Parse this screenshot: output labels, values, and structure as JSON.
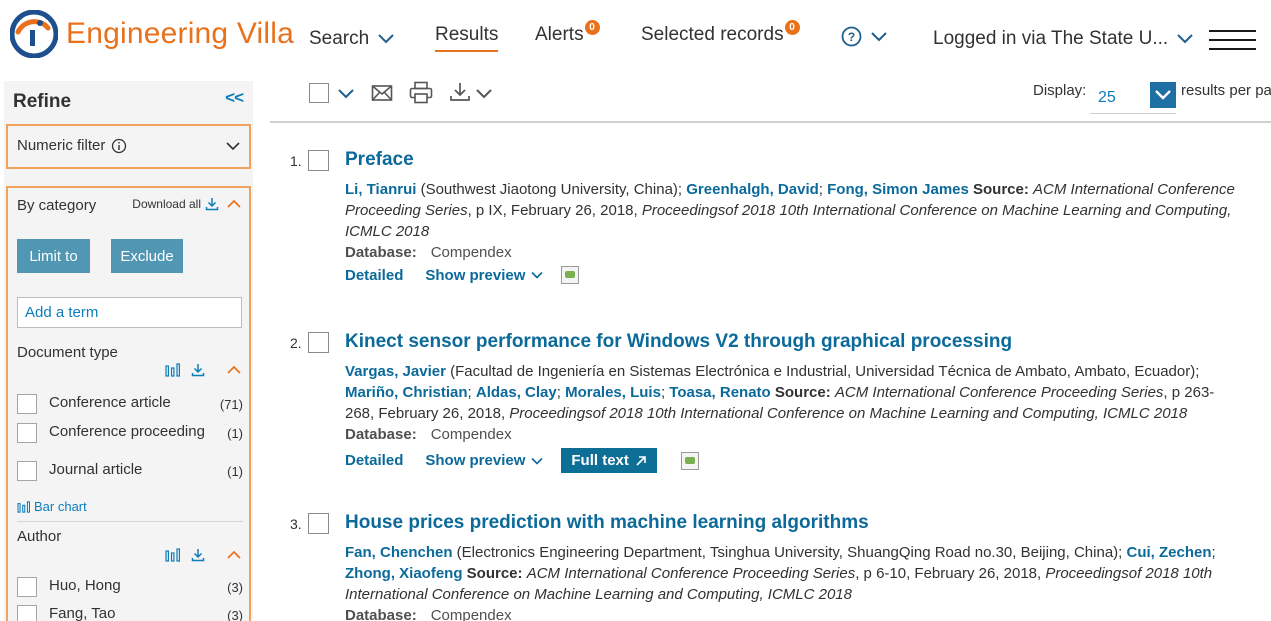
{
  "colors": {
    "brand": "#e9711c",
    "link": "#0c6a9a",
    "accent_blue": "#0c7dbb",
    "panel_border": "#f0a35e",
    "button": "#5197b3",
    "fulltext_button": "#0d6f96"
  },
  "header": {
    "brand_name": "Engineering Villa",
    "nav": {
      "search": "Search",
      "results": "Results",
      "alerts": "Alerts",
      "alerts_count": "0",
      "selected": "Selected records",
      "selected_count": "0",
      "help_icon": "question-circle-icon",
      "account": "Logged in via The State U..."
    }
  },
  "sidebar": {
    "title": "Refine",
    "collapse": "<<",
    "numeric_filter": "Numeric filter",
    "by_category": "By category",
    "download_all": "Download all",
    "limit_to": "Limit to",
    "exclude": "Exclude",
    "term_placeholder": "Add a term",
    "document_type": {
      "title": "Document type",
      "items": [
        {
          "label": "Conference article",
          "count": "(71)"
        },
        {
          "label": "Conference proceeding",
          "count": "(1)"
        },
        {
          "label": "Journal article",
          "count": "(1)"
        }
      ],
      "bar_chart": "Bar chart"
    },
    "author": {
      "title": "Author",
      "items": [
        {
          "label": "Huo, Hong",
          "count": "(3)"
        },
        {
          "label": "Fang, Tao",
          "count": "(3)"
        }
      ]
    }
  },
  "toolbar": {
    "display_label": "Display:",
    "display_value": "25",
    "per_page": "results per pa"
  },
  "results": [
    {
      "num": "1.",
      "title": "Preface",
      "authors": [
        {
          "name": "Li, Tianrui",
          "affil": " (Southwest Jiaotong University, China); "
        },
        {
          "name": "Greenhalgh, David",
          "affil": "; "
        },
        {
          "name": "Fong, Simon James",
          "affil": " "
        }
      ],
      "source_label": "Source:",
      "source_a": "ACM International Conference Proceeding Series",
      "source_b": ", p IX, February 26, 2018, ",
      "source_c": "Proceedingsof 2018 10th International Conference on Machine Learning and Computing, ICMLC 2018",
      "db_label": "Database:",
      "db_value": "Compendex",
      "detailed": "Detailed",
      "preview": "Show preview"
    },
    {
      "num": "2.",
      "title": "Kinect sensor performance for Windows V2 through graphical processing",
      "authors": [
        {
          "name": "Vargas, Javier",
          "affil": " (Facultad de Ingeniería en Sistemas Electrónica e Industrial, Universidad Técnica de Ambato, Ambato, Ecuador); "
        },
        {
          "name": "Mariño, Christian",
          "affil": "; "
        },
        {
          "name": "Aldas, Clay",
          "affil": "; "
        },
        {
          "name": "Morales, Luis",
          "affil": "; "
        },
        {
          "name": "Toasa, Renato",
          "affil": " "
        }
      ],
      "source_label": "Source:",
      "source_a": "ACM International Conference Proceeding Series",
      "source_b": ", p 263-268, February 26, 2018, ",
      "source_c": "Proceedingsof 2018 10th International Conference on Machine Learning and Computing, ICMLC 2018",
      "db_label": "Database:",
      "db_value": "Compendex",
      "detailed": "Detailed",
      "preview": "Show preview",
      "fulltext": "Full text"
    },
    {
      "num": "3.",
      "title": "House prices prediction with machine learning algorithms",
      "authors": [
        {
          "name": "Fan, Chenchen",
          "affil": " (Electronics Engineering Department, Tsinghua University, ShuangQing Road no.30, Beijing, China); "
        },
        {
          "name": "Cui, Zechen",
          "affil": "; "
        },
        {
          "name": "Zhong, Xiaofeng",
          "affil": " "
        }
      ],
      "source_label": "Source:",
      "source_a": "ACM International Conference Proceeding Series",
      "source_b": ", p 6-10, February 26, 2018, ",
      "source_c": "Proceedingsof 2018 10th International Conference on Machine Learning and Computing, ICMLC 2018",
      "db_label": "Database:",
      "db_value": "Compendex"
    }
  ]
}
